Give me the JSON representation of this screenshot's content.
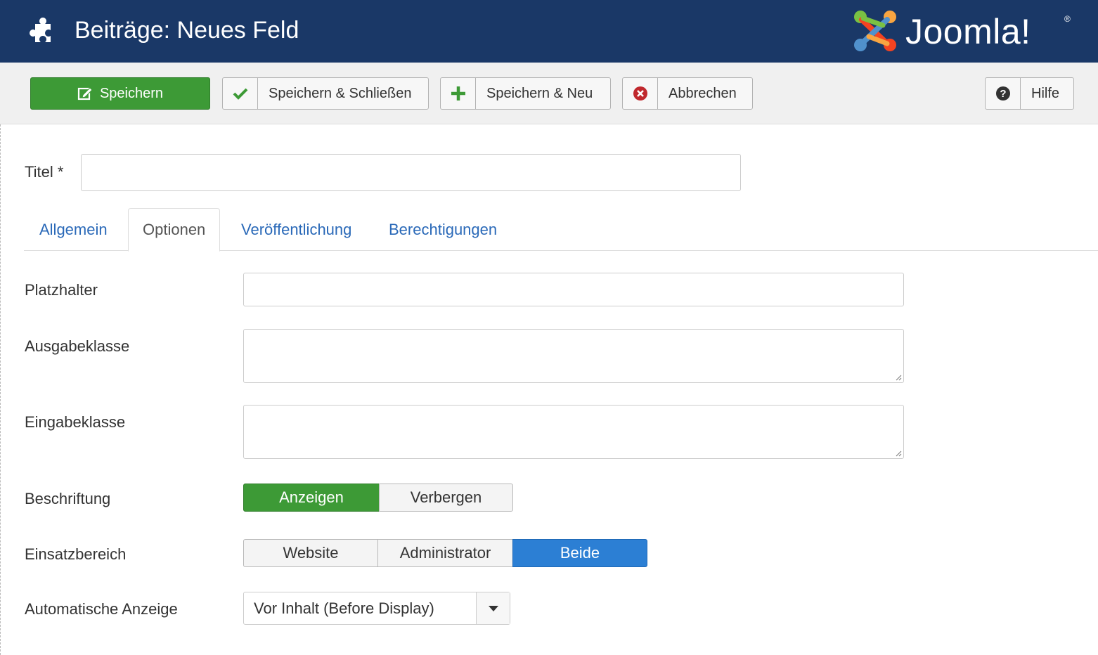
{
  "header": {
    "title": "Beiträge: Neues Feld",
    "logo_text": "Joomla!",
    "icon": "puzzle-icon",
    "background": "#1a3867"
  },
  "toolbar": {
    "save": "Speichern",
    "save_close": "Speichern & Schließen",
    "save_new": "Speichern & Neu",
    "cancel": "Abbrechen",
    "help": "Hilfe",
    "accent_green": "#3d9a36"
  },
  "form": {
    "title_label": "Titel *",
    "title_value": ""
  },
  "tabs": {
    "general": "Allgemein",
    "options": "Optionen",
    "publishing": "Veröffentlichung",
    "permissions": "Berechtigungen",
    "active": "Optionen"
  },
  "options": {
    "placeholder_label": "Platzhalter",
    "output_class_label": "Ausgabeklasse",
    "input_class_label": "Eingabeklasse",
    "caption_label": "Beschriftung",
    "caption_show": "Anzeigen",
    "caption_hide": "Verbergen",
    "caption_selected": "Anzeigen",
    "scope_label": "Einsatzbereich",
    "scope_site": "Website",
    "scope_admin": "Administrator",
    "scope_both": "Beide",
    "scope_selected": "Beide",
    "autodisplay_label": "Automatische Anzeige",
    "autodisplay_value": "Vor Inhalt (Before Display)",
    "accent_blue": "#2c7fd4"
  }
}
